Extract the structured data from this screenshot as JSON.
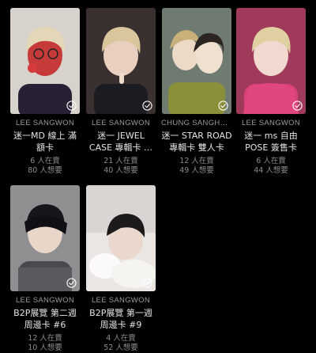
{
  "cards": [
    {
      "artist": "LEE SANGWON",
      "title": "迷一MD 線上 滿額卡",
      "have": "6 人在賣",
      "want": "80 人想要",
      "bg": "#d8d2cc",
      "hair": "#e3d7b8",
      "shirt": "#2a2034",
      "accent": "#c73a3a"
    },
    {
      "artist": "LEE SANGWON",
      "title": "迷一 JEWEL CASE 專輯卡 …",
      "have": "21 人在賣",
      "want": "40 人想要",
      "bg": "#3b3030",
      "hair": "#d9c69c",
      "shirt": "#1b1b22",
      "accent": "#e8cfc0"
    },
    {
      "artist": "CHUNG SANGHYE…",
      "title": "迷一 STAR ROAD 專輯卡 雙人卡",
      "have": "12 人在賣",
      "want": "49 人想要",
      "bg": "#6f7a70",
      "hair": "#2c2420",
      "shirt": "#8b8f3a",
      "accent": "#efe4d6"
    },
    {
      "artist": "LEE SANGWON",
      "title": "迷一 ms 自由 POSE 簽售卡",
      "have": "6 人在賣",
      "want": "44 人想要",
      "bg": "#a03a5a",
      "hair": "#e0cfa0",
      "shirt": "#d8407a",
      "accent": "#f2d9cf"
    },
    {
      "artist": "LEE SANGWON",
      "title": "B2P展覽 第二週 周邊卡 #6",
      "have": "12 人在賣",
      "want": "10 人想要",
      "bg": "#8f8f92",
      "hair": "#15151a",
      "shirt": "#4a4a4e",
      "accent": "#e8d6c8"
    },
    {
      "artist": "LEE SANGWON",
      "title": "B2P展覽 第一週 周邊卡 #9",
      "have": "4 人在賣",
      "want": "52 人想要",
      "bg": "#d9d5d2",
      "hair": "#1c1a1a",
      "shirt": "#f2f0ee",
      "accent": "#ead8cc"
    }
  ]
}
